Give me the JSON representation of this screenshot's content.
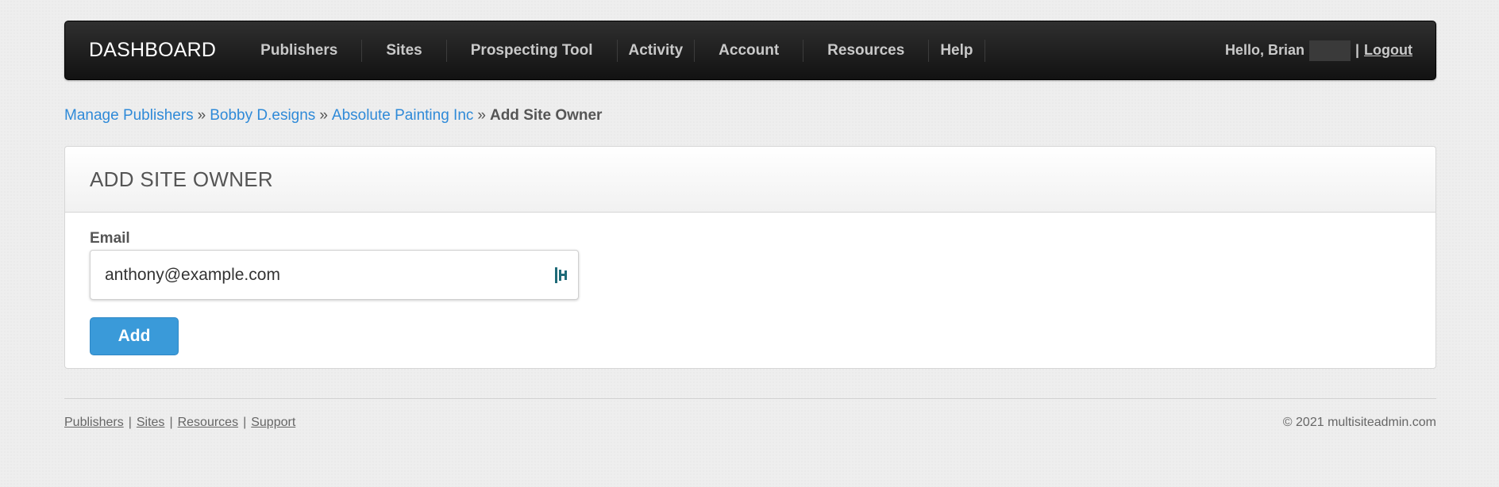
{
  "navbar": {
    "brand": "DASHBOARD",
    "items": [
      {
        "label": "Publishers"
      },
      {
        "label": "Sites"
      },
      {
        "label": "Prospecting Tool"
      },
      {
        "label": "Activity"
      },
      {
        "label": "Account"
      },
      {
        "label": "Resources"
      },
      {
        "label": "Help"
      }
    ],
    "greeting": "Hello, Brian",
    "separator": "|",
    "logout": "Logout"
  },
  "breadcrumb": {
    "items": [
      "Manage Publishers",
      "Bobby D.esigns",
      "Absolute Painting Inc"
    ],
    "separator": "»",
    "current": "Add Site Owner"
  },
  "panel": {
    "title": "ADD SITE OWNER",
    "email_label": "Email",
    "email_value": "anthony@example.com",
    "add_button": "Add"
  },
  "footer": {
    "links": [
      "Publishers",
      "Sites",
      "Resources",
      "Support"
    ],
    "separator": "|",
    "copyright": "© 2021 multisiteadmin.com"
  },
  "colors": {
    "navbar": "#1a1a1a",
    "link": "#2f8ad8",
    "button": "#3a9ad9",
    "password_icon": "#1f6b78"
  },
  "icons": {
    "password_manager": "password-manager-icon"
  }
}
